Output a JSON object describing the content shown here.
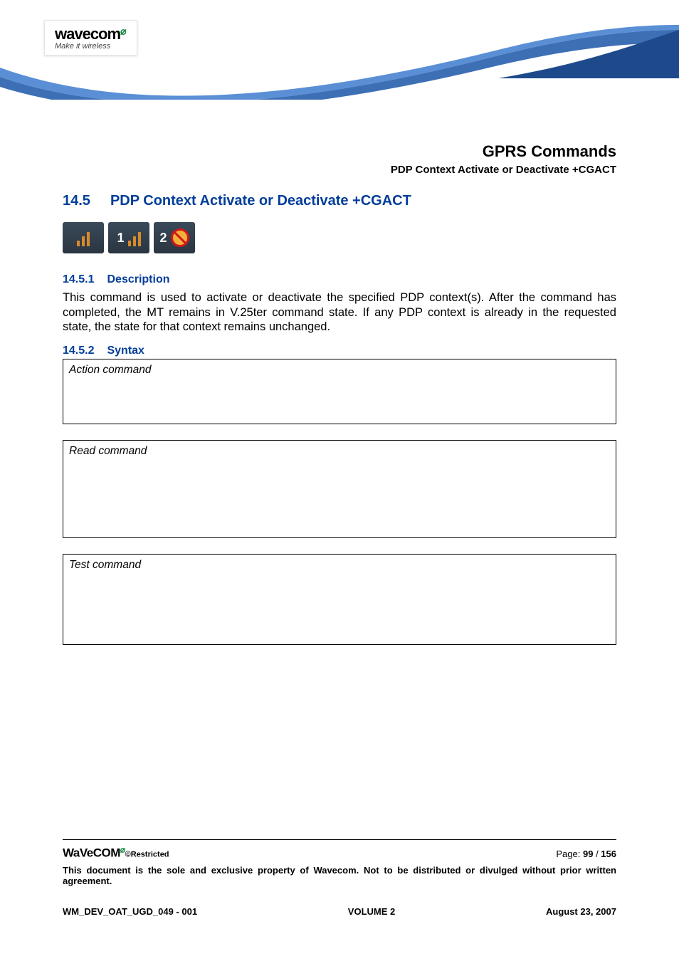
{
  "logo": {
    "brand": "wavecom",
    "tagline": "Make it wireless"
  },
  "header": {
    "title": "GPRS Commands",
    "subtitle": "PDP Context Activate or Deactivate +CGACT"
  },
  "section": {
    "number": "14.5",
    "title": "PDP Context Activate or Deactivate +CGACT"
  },
  "icons": [
    {
      "label": "",
      "type": "sim"
    },
    {
      "label": "1",
      "type": "sim"
    },
    {
      "label": "2",
      "type": "prohibit"
    }
  ],
  "description": {
    "number": "14.5.1",
    "title": "Description",
    "text": "This command is used to activate or deactivate the specified PDP context(s). After the command has completed, the MT remains in V.25ter command state. If any PDP context is already in the requested state, the state for that context remains unchanged."
  },
  "syntax": {
    "number": "14.5.2",
    "title": "Syntax",
    "boxes": [
      {
        "label": "Action command"
      },
      {
        "label": "Read command"
      },
      {
        "label": "Test command"
      }
    ]
  },
  "footer": {
    "brand": "WaVeCOM",
    "restricted": "©Restricted",
    "page_label": "Page: ",
    "page_current": "99",
    "page_sep": " / ",
    "page_total": "156",
    "disclaimer": "This document is the sole and exclusive property of Wavecom. Not to be distributed or divulged without prior written agreement.",
    "doc_id": "WM_DEV_OAT_UGD_049 - 001",
    "volume": "VOLUME 2",
    "date": "August 23, 2007"
  }
}
